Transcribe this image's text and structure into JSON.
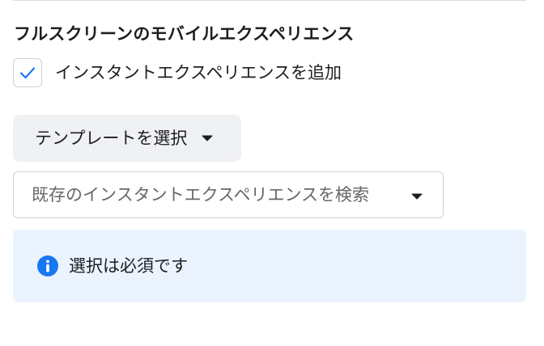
{
  "section": {
    "title": "フルスクリーンのモバイルエクスペリエンス"
  },
  "instant_experience_checkbox": {
    "label": "インスタントエクスペリエンスを追加",
    "checked": true,
    "check_color": "#1877f2"
  },
  "template_select": {
    "label": "テンプレートを選択",
    "icon": "caret-down-icon"
  },
  "existing_search": {
    "placeholder": "既存のインスタントエクスペリエンスを検索",
    "icon": "caret-down-icon"
  },
  "notice": {
    "icon": "info-icon",
    "icon_color": "#1877f2",
    "background": "#ebf3ff",
    "text": "選択は必須です"
  }
}
